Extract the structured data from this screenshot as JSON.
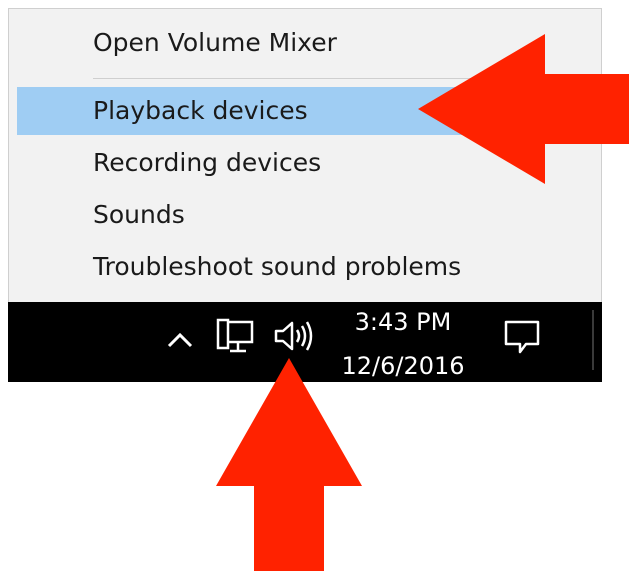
{
  "context_menu": {
    "items": [
      {
        "label": "Open Volume Mixer"
      },
      {
        "label": "Playback devices",
        "highlighted": true
      },
      {
        "label": "Recording devices"
      },
      {
        "label": "Sounds"
      },
      {
        "label": "Troubleshoot sound problems"
      }
    ]
  },
  "taskbar": {
    "time": "3:43 PM",
    "date": "12/6/2016",
    "icons": [
      "chevron-up-icon",
      "network-icon",
      "speaker-icon",
      "action-center-icon"
    ]
  },
  "annotations": {
    "arrow_color": "#ff2200",
    "highlight_color": "#9fcdf3"
  }
}
